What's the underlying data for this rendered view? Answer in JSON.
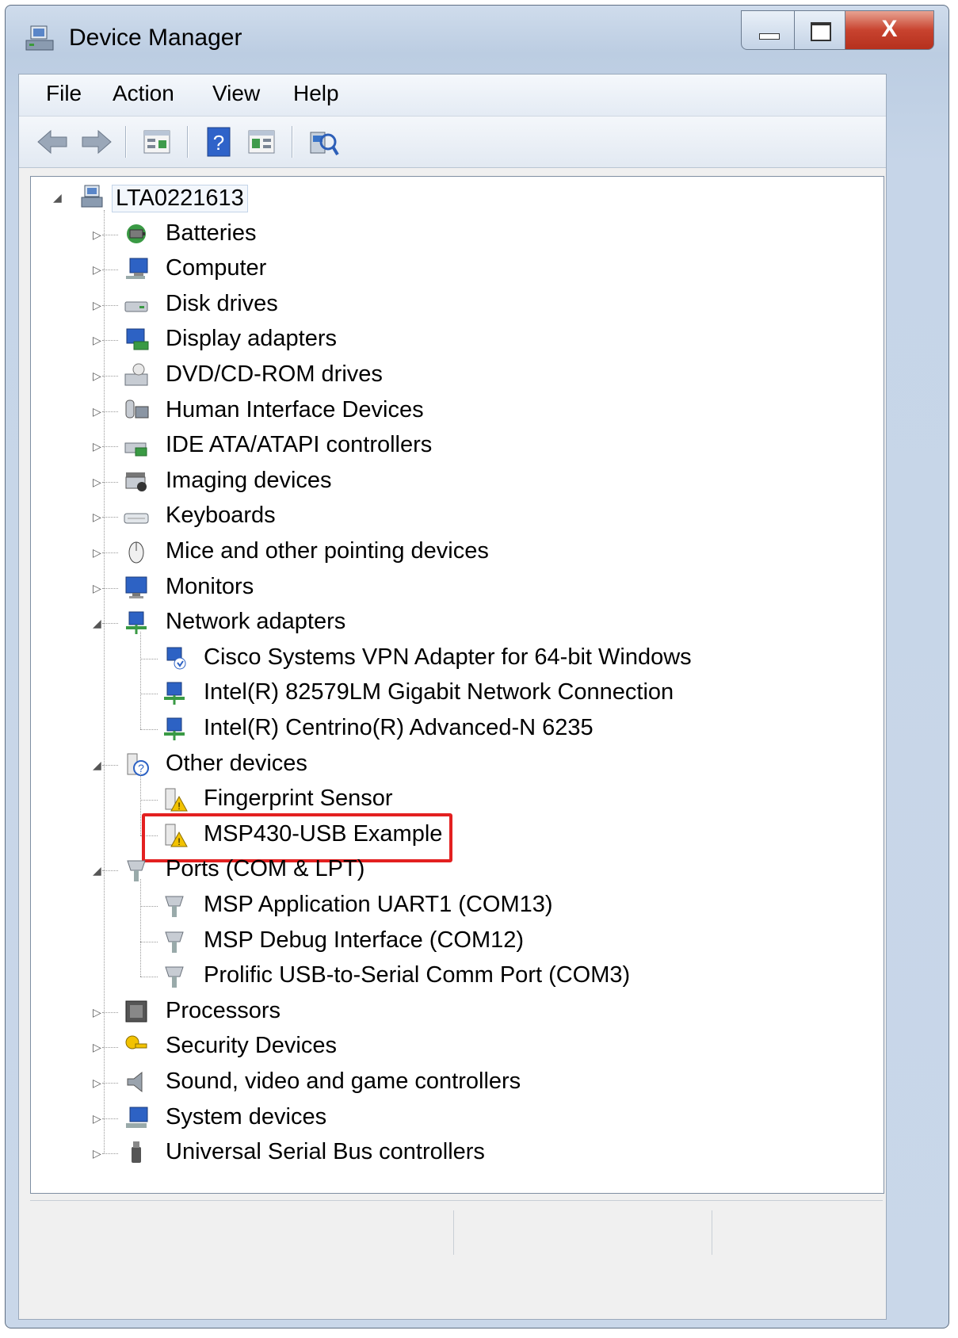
{
  "window": {
    "title": "Device Manager",
    "buttons": {
      "minimize": "minimize",
      "maximize": "maximize",
      "close": "X"
    }
  },
  "menu": [
    "File",
    "Action",
    "View",
    "Help"
  ],
  "toolbar": [
    "back-icon",
    "forward-icon",
    "properties-icon",
    "help-icon",
    "view-icon",
    "scan-hardware-icon"
  ],
  "tree": {
    "root": "LTA0221613",
    "categories": [
      {
        "label": "Batteries",
        "icon": "battery-icon",
        "expanded": false,
        "children": []
      },
      {
        "label": "Computer",
        "icon": "computer-icon",
        "expanded": false,
        "children": []
      },
      {
        "label": "Disk drives",
        "icon": "disk-drive-icon",
        "expanded": false,
        "children": []
      },
      {
        "label": "Display adapters",
        "icon": "display-adapter-icon",
        "expanded": false,
        "children": []
      },
      {
        "label": "DVD/CD-ROM drives",
        "icon": "dvd-drive-icon",
        "expanded": false,
        "children": []
      },
      {
        "label": "Human Interface Devices",
        "icon": "hid-icon",
        "expanded": false,
        "children": []
      },
      {
        "label": "IDE ATA/ATAPI controllers",
        "icon": "ide-controller-icon",
        "expanded": false,
        "children": []
      },
      {
        "label": "Imaging devices",
        "icon": "imaging-icon",
        "expanded": false,
        "children": []
      },
      {
        "label": "Keyboards",
        "icon": "keyboard-icon",
        "expanded": false,
        "children": []
      },
      {
        "label": "Mice and other pointing devices",
        "icon": "mouse-icon",
        "expanded": false,
        "children": []
      },
      {
        "label": "Monitors",
        "icon": "monitor-icon",
        "expanded": false,
        "children": []
      },
      {
        "label": "Network adapters",
        "icon": "network-adapter-icon",
        "expanded": true,
        "children": [
          "Cisco Systems VPN Adapter for 64-bit Windows",
          "Intel(R) 82579LM Gigabit Network Connection",
          "Intel(R) Centrino(R) Advanced-N 6235"
        ]
      },
      {
        "label": "Other devices",
        "icon": "unknown-device-icon",
        "expanded": true,
        "children": [
          "Fingerprint Sensor",
          "MSP430-USB Example"
        ]
      },
      {
        "label": "Ports (COM & LPT)",
        "icon": "port-icon",
        "expanded": true,
        "children": [
          "MSP Application UART1 (COM13)",
          "MSP Debug Interface (COM12)",
          "Prolific USB-to-Serial Comm Port (COM3)"
        ]
      },
      {
        "label": "Processors",
        "icon": "processor-icon",
        "expanded": false,
        "children": []
      },
      {
        "label": "Security Devices",
        "icon": "security-key-icon",
        "expanded": false,
        "children": []
      },
      {
        "label": "Sound, video and game controllers",
        "icon": "speaker-icon",
        "expanded": false,
        "children": []
      },
      {
        "label": "System devices",
        "icon": "system-device-icon",
        "expanded": false,
        "children": []
      },
      {
        "label": "Universal Serial Bus controllers",
        "icon": "usb-icon",
        "expanded": false,
        "children": []
      }
    ]
  },
  "highlight": {
    "item": "MSP430-USB Example",
    "color": "#e32020"
  },
  "colors": {
    "titlebar": "#bccde2",
    "close_button": "#c8432f",
    "warning": "#f2c200"
  }
}
